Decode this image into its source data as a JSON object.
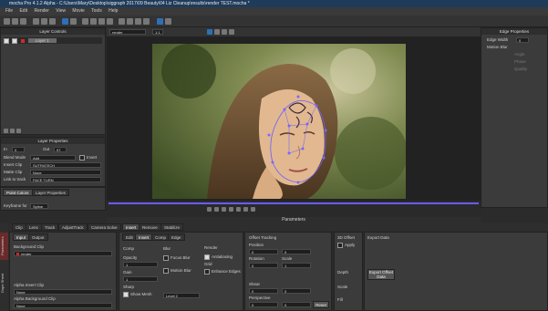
{
  "window": {
    "title": "mocha Pro 4.1.2 Alpha - C:\\Users\\Mary\\Desktop\\siggraph 2017\\09 Beauty\\04 Liz Cleanup\\results\\render TEST.mocha *"
  },
  "menu": [
    "File",
    "Edit",
    "Render",
    "View",
    "Movie",
    "Tools",
    "Help"
  ],
  "layer_controls": {
    "title": "Layer Controls",
    "layer_name": "Layer 1"
  },
  "layer_properties": {
    "title": "Layer Properties",
    "in_label": "In",
    "in_value": "0",
    "out_label": "Out",
    "out_value": "97",
    "blend_mode_label": "Blend Mode",
    "blend_mode_value": "Add",
    "invert_label": "Invert",
    "insert_clip_label": "Insert Clip",
    "insert_clip_value": "SUTRATECH",
    "matte_clip_label": "Matte Clip",
    "matte_clip_value": "None",
    "link_label": "Link to track",
    "link_value": "FACE TURN"
  },
  "keyframe_controls": {
    "title": "Keyframe Controls",
    "tabs": [
      "Point Colors",
      "Layer Properties"
    ],
    "keyframe_label": "Keyframe for",
    "keyframe_value": "Spline"
  },
  "viewer": {
    "clip_value": "render",
    "frame_value": "1:1"
  },
  "edge_properties": {
    "title": "Edge Properties",
    "edge_width_label": "Edge Width",
    "edge_width_value": "0",
    "motion_blur_label": "Motion Blur",
    "angle_label": "Angle",
    "phase_label": "Phase",
    "quality_label": "Quality"
  },
  "parameters": {
    "title": "Parameters"
  },
  "module_tabs": [
    "Clip",
    "Lens",
    "Track",
    "AdjustTrack",
    "Camera Solve",
    "Insert",
    "Remove",
    "Stabilize"
  ],
  "sidebar_vertical": {
    "label1": "Parameters",
    "label2": "Dope Sheet"
  },
  "insert_sub_tabs": [
    "Input",
    "Output"
  ],
  "input": {
    "bg_clip_label": "Background Clip",
    "bg_clip_value": "render",
    "alpha_insert_label": "Alpha Insert Clip",
    "alpha_insert_value": "None",
    "alpha_bg_label": "Alpha Background Clip",
    "alpha_bg_value": "None"
  },
  "render_tabs": [
    "Edit",
    "Insert",
    "Comp",
    "Edge"
  ],
  "comp": {
    "title": "Comp",
    "opacity_label": "Opacity",
    "opacity_value": "1",
    "gain_label": "Gain",
    "gain_value": "1",
    "sharp_label": "Sharp",
    "show_mesh_label": "Show Mesh"
  },
  "blur": {
    "title": "Blur",
    "focus_blur_label": "Focus Blur",
    "motion_blur_label": "Motion Blur",
    "level_label": "Level 2"
  },
  "render": {
    "title": "Render",
    "antialias_label": "Antialiasing",
    "grid_label": "Grid",
    "enhance_label": "Enhance Edges"
  },
  "offset_tracking": {
    "title": "Offset Tracking",
    "position_label": "Position",
    "pos_x": "0",
    "pos_y": "0",
    "rotation_label": "Rotation",
    "rotation_value": "0",
    "scale_label": "Scale",
    "scale_value": "1",
    "shear_label": "Shear",
    "shear_x": "0",
    "shear_y": "0",
    "perspective_label": "Perspective",
    "persp_x": "0",
    "persp_y": "0",
    "reset_label": "Reset"
  },
  "offset_3d": {
    "title": "3D Offset",
    "apply_label": "Apply",
    "depth_label": "Depth",
    "scale_label": "Scale",
    "fill_label": "Fill"
  },
  "export": {
    "title": "Export Data",
    "button_label": "Export Offset Data"
  }
}
